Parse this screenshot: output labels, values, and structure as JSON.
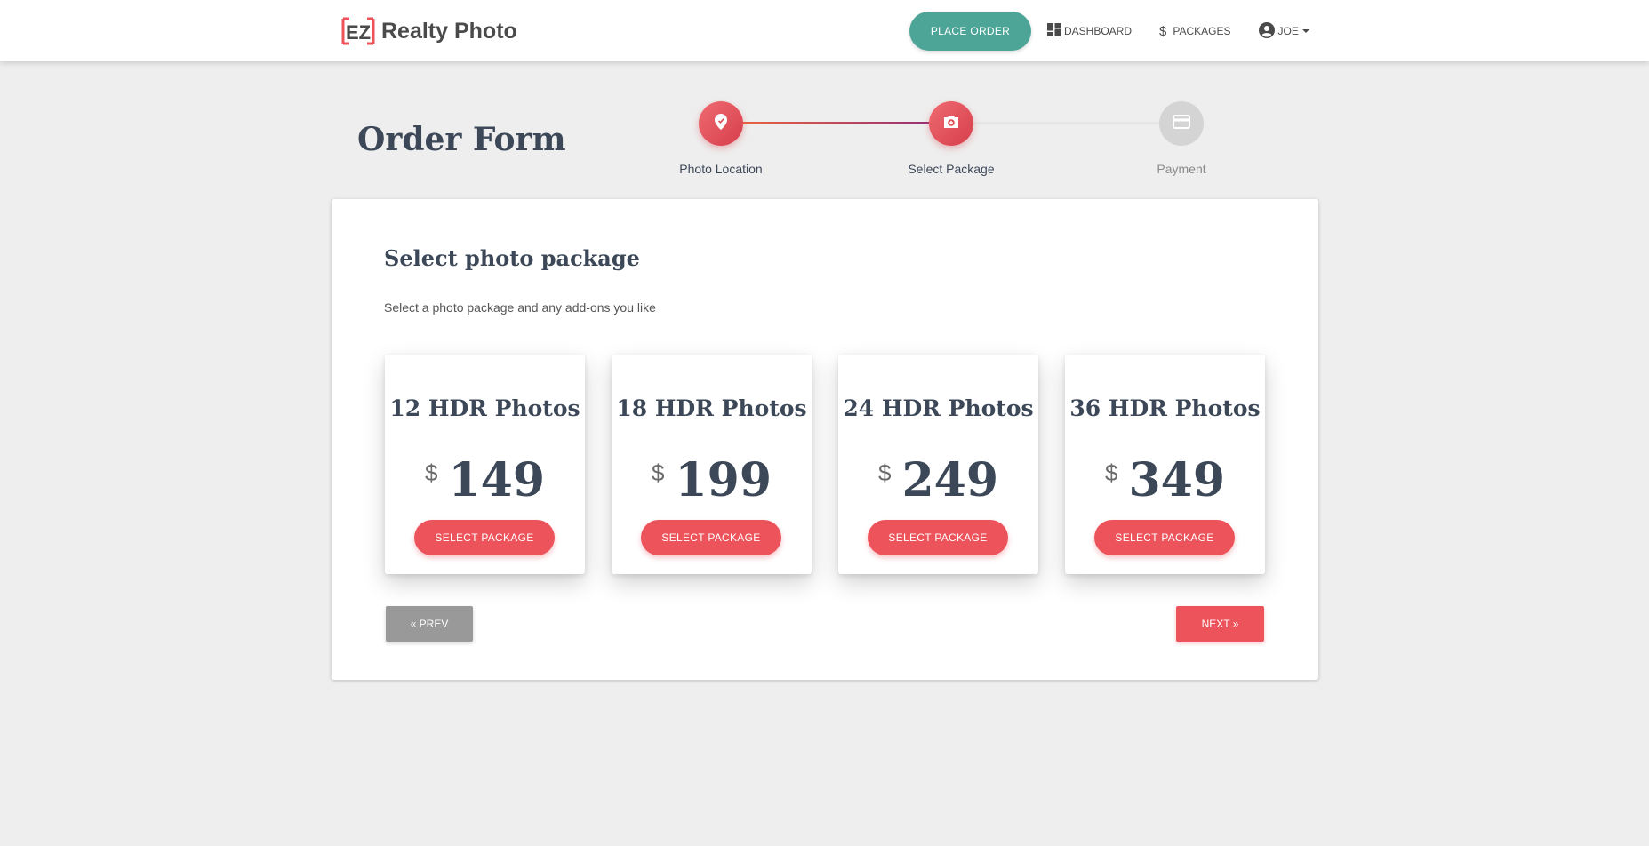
{
  "navbar": {
    "logo_text": "EZ",
    "brand_name": "Realty Photo",
    "place_order_label": "PLACE ORDER",
    "dashboard_label": "DASHBOARD",
    "packages_label": "PACKAGES",
    "user_label": "JOE",
    "icons": [
      "dashboard-icon",
      "dollar-icon",
      "account-circle-icon",
      "caret-down-icon"
    ]
  },
  "header": {
    "title": "Order Form"
  },
  "stepper": {
    "steps": [
      {
        "label": "Photo Location",
        "icon": "location-pin-icon",
        "state": "complete"
      },
      {
        "label": "Select Package",
        "icon": "camera-icon",
        "state": "active"
      },
      {
        "label": "Payment",
        "icon": "credit-card-icon",
        "state": "pending"
      }
    ]
  },
  "main": {
    "section_title": "Select photo package",
    "section_subtitle": "Select a photo package and any add-ons you like",
    "packages": [
      {
        "title": "12 HDR Photos",
        "currency": "$",
        "price": "149",
        "button_label": "SELECT PACKAGE"
      },
      {
        "title": "18 HDR Photos",
        "currency": "$",
        "price": "199",
        "button_label": "SELECT PACKAGE"
      },
      {
        "title": "24 HDR Photos",
        "currency": "$",
        "price": "249",
        "button_label": "SELECT PACKAGE"
      },
      {
        "title": "36 HDR Photos",
        "currency": "$",
        "price": "349",
        "button_label": "SELECT PACKAGE"
      }
    ],
    "prev_label": "« PREV",
    "next_label": "NEXT »"
  },
  "colors": {
    "accent": "#ec535b",
    "teal": "#4ca597",
    "text_dark": "#3c4858",
    "background": "#eeeeee"
  }
}
